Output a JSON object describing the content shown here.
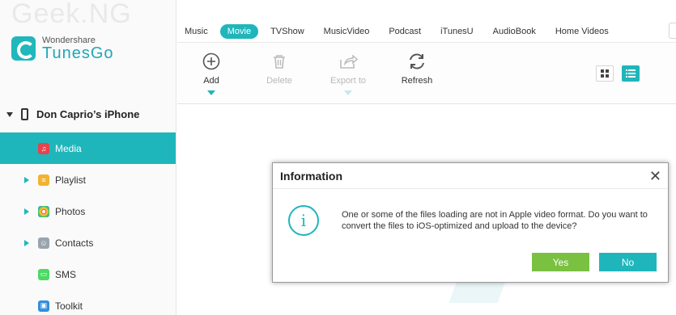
{
  "watermark": "Geek.NG",
  "brand": {
    "small": "Wondershare",
    "name": "TunesGo"
  },
  "device": {
    "name": "Don Caprio’s iPhone"
  },
  "sidebar": {
    "items": [
      {
        "label": "Media",
        "icon": "music-note-icon"
      },
      {
        "label": "Playlist",
        "icon": "playlist-icon"
      },
      {
        "label": "Photos",
        "icon": "photos-icon"
      },
      {
        "label": "Contacts",
        "icon": "contacts-icon"
      },
      {
        "label": "SMS",
        "icon": "sms-icon"
      },
      {
        "label": "Toolkit",
        "icon": "toolkit-icon"
      }
    ]
  },
  "tabs": [
    "Music",
    "Movie",
    "TVShow",
    "MusicVideo",
    "Podcast",
    "iTunesU",
    "AudioBook",
    "Home Videos"
  ],
  "toolbar": {
    "add": "Add",
    "delete": "Delete",
    "export": "Export to",
    "refresh": "Refresh"
  },
  "dialog": {
    "title": "Information",
    "message": "One or some of the files loading are not in Apple video format. Do you want to convert the files to iOS-optimized and upload to the device?",
    "yes": "Yes",
    "no": "No"
  },
  "colors": {
    "accent": "#1fb6bb",
    "yes": "#7ac142"
  }
}
